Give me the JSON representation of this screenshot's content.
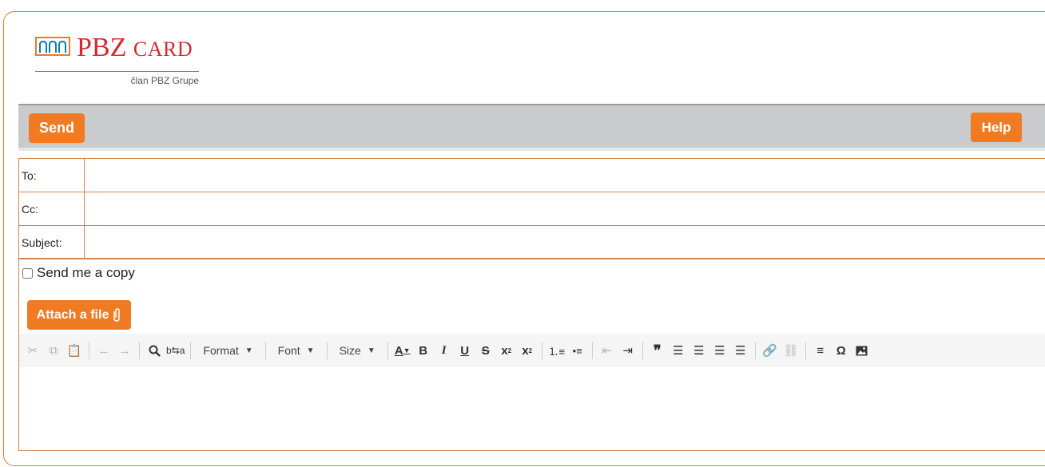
{
  "brand": {
    "name": "PBZ",
    "name_suffix": "CARD",
    "subtitle": "član PBZ Grupe",
    "brand_color": "#d6282e",
    "accent_color": "#f07b22"
  },
  "toolbar": {
    "send_label": "Send",
    "help_label": "Help"
  },
  "form": {
    "to_label": "To:",
    "to_value": "",
    "cc_label": "Cc:",
    "cc_value": "",
    "subject_label": "Subject:",
    "subject_value": ""
  },
  "copy": {
    "label": "Send me a copy",
    "checked": false
  },
  "attach": {
    "label": "Attach a file",
    "icon": "paperclip-icon"
  },
  "editor": {
    "format_label": "Format",
    "font_label": "Font",
    "size_label": "Size",
    "icons": [
      "cut-icon",
      "copy-icon",
      "paste-icon",
      "undo-icon",
      "redo-icon",
      "find-icon",
      "replace-icon",
      "text-color-icon",
      "bold-icon",
      "italic-icon",
      "underline-icon",
      "strikethrough-icon",
      "subscript-icon",
      "superscript-icon",
      "numbered-list-icon",
      "bulleted-list-icon",
      "outdent-icon",
      "indent-icon",
      "blockquote-icon",
      "align-left-icon",
      "align-center-icon",
      "align-right-icon",
      "justify-icon",
      "link-icon",
      "unlink-icon",
      "horizontal-rule-icon",
      "special-char-icon",
      "image-icon"
    ],
    "content": ""
  }
}
